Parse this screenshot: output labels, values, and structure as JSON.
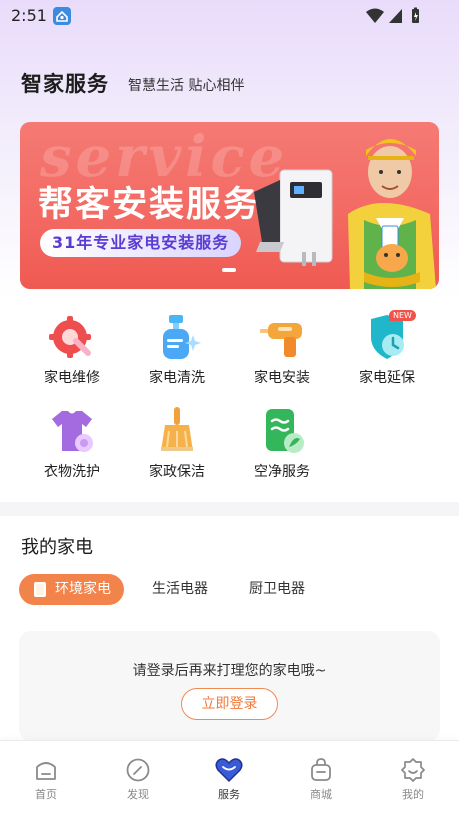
{
  "status_bar": {
    "time": "2:51"
  },
  "header": {
    "title": "智家服务",
    "subtitle": "智慧生活 贴心相伴"
  },
  "banner": {
    "watermark": "service",
    "title": "帮客安装服务",
    "tagline": "31年专业家电安装服务"
  },
  "services": [
    {
      "label": "家电维修",
      "icon": "repair-gear-icon"
    },
    {
      "label": "家电清洗",
      "icon": "spray-bottle-icon"
    },
    {
      "label": "家电安装",
      "icon": "drill-icon"
    },
    {
      "label": "家电延保",
      "icon": "shield-clock-icon",
      "badge": "NEW"
    },
    {
      "label": "衣物洗护",
      "icon": "shirt-icon"
    },
    {
      "label": "家政保洁",
      "icon": "broom-icon"
    },
    {
      "label": "空净服务",
      "icon": "air-purifier-icon"
    }
  ],
  "my_appliances": {
    "title": "我的家电",
    "tabs": [
      {
        "label": "环境家电",
        "active": true
      },
      {
        "label": "生活电器",
        "active": false
      },
      {
        "label": "厨卫电器",
        "active": false
      }
    ],
    "login_prompt": "请登录后再来打理您的家电哦~",
    "login_button": "立即登录"
  },
  "bottom_nav": [
    {
      "label": "首页",
      "icon": "home-icon",
      "active": false
    },
    {
      "label": "发现",
      "icon": "compass-icon",
      "active": false
    },
    {
      "label": "服务",
      "icon": "heart-icon",
      "active": true
    },
    {
      "label": "商城",
      "icon": "shopping-bag-icon",
      "active": false
    },
    {
      "label": "我的",
      "icon": "profile-icon",
      "active": false
    }
  ],
  "colors": {
    "accent": "#f2834a",
    "banner_red": "#f36a63",
    "nav_active": "#3a5bd9"
  }
}
